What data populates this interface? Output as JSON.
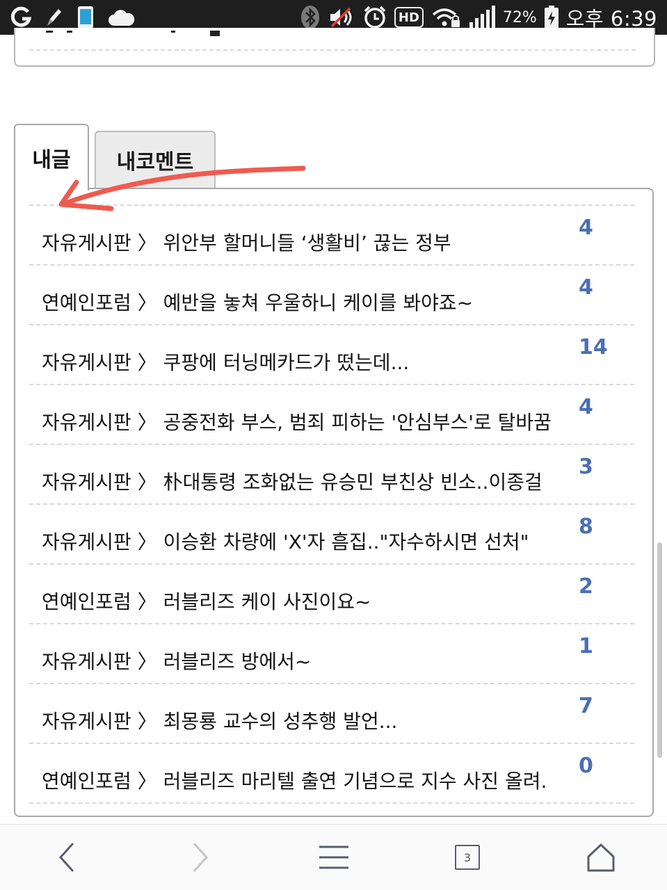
{
  "status_bar": {
    "battery_percent": "72%",
    "time": "오후 6:39",
    "hd_label": "HD",
    "icons": [
      "g-app-icon",
      "pen-icon",
      "phone-icon",
      "cloud-icon",
      "bluetooth-icon",
      "mute-icon",
      "alarm-icon",
      "hd-voice-icon",
      "wifi-lock-icon",
      "signal-icon",
      "battery-charging-icon"
    ]
  },
  "tabs": [
    {
      "label": "내글",
      "active": true
    },
    {
      "label": "내코멘트",
      "active": false
    }
  ],
  "posts": [
    {
      "board": "자유게시판",
      "title": "위안부 할머니들 ‘생활비’ 끊는 정부",
      "count": "4"
    },
    {
      "board": "연예인포럼",
      "title": "예반을 놓쳐 우울하니 케이를 봐야죠~",
      "count": "4"
    },
    {
      "board": "자유게시판",
      "title": "쿠팡에 터닝메카드가 떴는데...",
      "count": "14"
    },
    {
      "board": "자유게시판",
      "title": "공중전화 부스, 범죄 피하는 '안심부스'로 탈바꿈",
      "count": "4"
    },
    {
      "board": "자유게시판",
      "title": "朴대통령 조화없는 유승민 부친상 빈소..이종걸",
      "count": "3"
    },
    {
      "board": "자유게시판",
      "title": "이승환 차량에 'X'자 흠집..\"자수하시면 선처\"",
      "count": "8"
    },
    {
      "board": "연예인포럼",
      "title": "러블리즈 케이 사진이요~",
      "count": "2"
    },
    {
      "board": "자유게시판",
      "title": "러블리즈 방에서~",
      "count": "1"
    },
    {
      "board": "자유게시판",
      "title": "최몽룡 교수의 성추행 발언...",
      "count": "7"
    },
    {
      "board": "연예인포럼",
      "title": "러블리즈 마리텔 출연 기념으로 지수 사진 올려.",
      "count": "0"
    }
  ],
  "separator": "〉",
  "bottom_nav": {
    "tab_count": "3",
    "items": [
      "back-icon",
      "forward-icon",
      "menu-icon",
      "tabs-icon",
      "home-icon"
    ]
  },
  "colors": {
    "count": "#4a6fb5",
    "annotation_arrow": "#f05a4e",
    "status_bar": "#1e1e1e"
  }
}
